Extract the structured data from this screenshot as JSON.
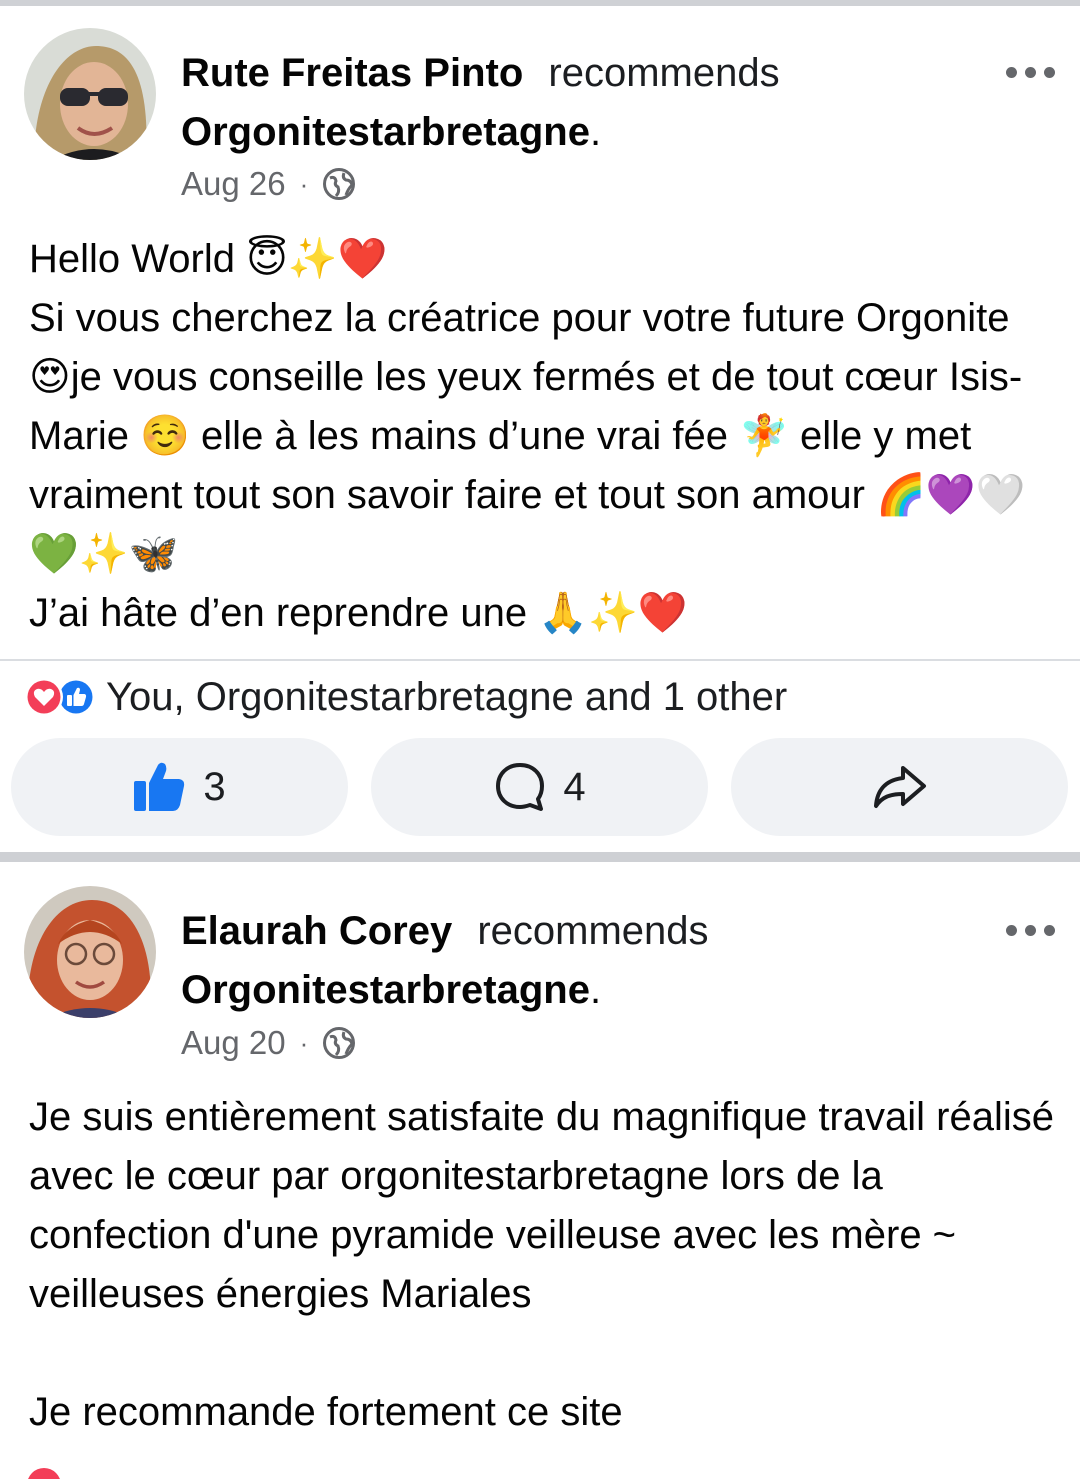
{
  "posts": [
    {
      "author": "Rute Freitas Pinto",
      "action": "recommends",
      "page": "Orgonitestarbretagne",
      "date": "Aug 26",
      "date_separator": "·",
      "privacy_icon": "globe-icon",
      "avatar_icon": "profile-photo",
      "body": "Hello World 😇✨❤️\nSi vous cherchez la créatrice pour votre future Orgonite 😍je vous conseille les yeux fermés et de tout cœur Isis-Marie ☺️ elle à les mains d’une vrai fée 🧚 elle y met vraiment tout son savoir faire et tout son amour 🌈💜🤍💚✨🦋\nJ’ai hâte d’en reprendre une 🙏✨❤️",
      "reactions_summary": "You, Orgonitestarbretagne and 1 other",
      "like_count": "3",
      "comment_count": "4"
    },
    {
      "author": "Elaurah Corey",
      "action": "recommends",
      "page": "Orgonitestarbretagne",
      "date": "Aug 20",
      "date_separator": "·",
      "privacy_icon": "globe-icon",
      "avatar_icon": "profile-photo",
      "body": "Je suis entièrement satisfaite du magnifique travail réalisé avec le cœur par orgonitestarbretagne lors de la confection d'une pyramide veilleuse avec les mère ~ veilleuses énergies Mariales\n\nJe recommande fortement ce site"
    }
  ],
  "punctuation": {
    "period": "."
  },
  "colors": {
    "like_blue": "#1877f2",
    "love_red": "#f33e58",
    "meta_gray": "#65676b",
    "button_bg": "#f0f2f5",
    "separator": "#ced0d4"
  }
}
